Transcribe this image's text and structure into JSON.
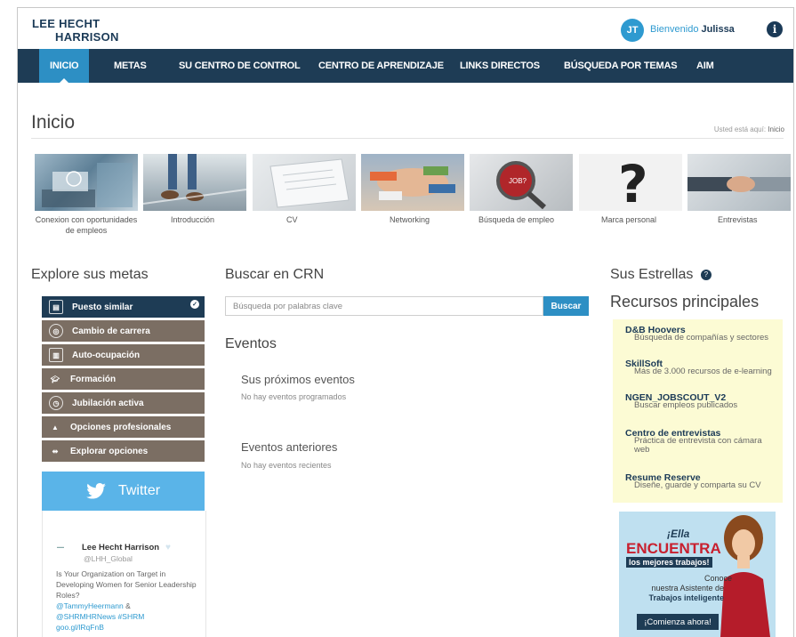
{
  "header": {
    "logo_line1": "LEE HECHT",
    "logo_line2": "HARRISON",
    "avatar_initials": "JT",
    "welcome_text": "Bienvenido",
    "user_name": "Julissa"
  },
  "nav": [
    {
      "label": "INICIO",
      "active": true
    },
    {
      "label": "METAS"
    },
    {
      "label": "SU CENTRO DE CONTROL"
    },
    {
      "label": "CENTRO DE APRENDIZAJE"
    },
    {
      "label": "LINKS DIRECTOS"
    },
    {
      "label": "BÚSQUEDA POR TEMAS"
    },
    {
      "label": "AIM"
    }
  ],
  "page": {
    "title": "Inicio",
    "breadcrumb_prefix": "Usted está aquí:",
    "breadcrumb_current": "Inicio"
  },
  "tiles": [
    {
      "label": "Conexion con oportunidades de empleos",
      "icon": "laptop-hands-image"
    },
    {
      "label": "Introducción",
      "icon": "walking-feet-image"
    },
    {
      "label": "CV",
      "icon": "paper-image"
    },
    {
      "label": "Networking",
      "icon": "stacked-hands-image"
    },
    {
      "label": "Búsqueda de empleo",
      "icon": "magnifier-puzzle-image"
    },
    {
      "label": "Marca personal",
      "icon": "question-mark-image"
    },
    {
      "label": "Entrevistas",
      "icon": "handshake-image"
    }
  ],
  "goals": {
    "heading": "Explore sus metas",
    "items": [
      {
        "label": "Puesto similar",
        "active": true
      },
      {
        "label": "Cambio de carrera"
      },
      {
        "label": "Auto-ocupación"
      },
      {
        "label": "Formación"
      },
      {
        "label": "Jubilación activa"
      },
      {
        "label": "Opciones profesionales"
      },
      {
        "label": "Explorar opciones"
      }
    ],
    "colors": {
      "active": "#1e3c55",
      "inactive": "#7b6e63"
    }
  },
  "twitter": {
    "label": "Twitter",
    "account_name": "Lee Hecht Harrison",
    "handle": "@LHH_Global",
    "tweet_text": "Is Your Organization on Target in Developing Women for Senior Leadership Roles?",
    "tweet_mention": "@TammyHeermann",
    "tweet_amp": "&",
    "tweet_tags": "@SHRMHRNews #SHRM",
    "tweet_url": "goo.gl/lRqFnB"
  },
  "search": {
    "heading": "Buscar en CRN",
    "placeholder": "Búsqueda por palabras clave",
    "button": "Buscar"
  },
  "events": {
    "heading": "Eventos",
    "upcoming_title": "Sus próximos eventos",
    "upcoming_empty": "No hay eventos programados",
    "past_title": "Eventos anteriores",
    "past_empty": "No hay eventos recientes"
  },
  "right": {
    "stars_heading": "Sus Estrellas",
    "resources_heading": "Recursos principales",
    "resources": [
      {
        "title": "D&B Hoovers",
        "desc": "Búsqueda de compañías y sectores"
      },
      {
        "title": "SkillSoft",
        "desc": "Más de 3.000 recursos de e-learning"
      },
      {
        "title": "NGEN_JOBSCOUT_V2",
        "desc": "Buscar empleos publicados"
      },
      {
        "title": "Centro de entrevistas",
        "desc": "Práctica de entrevista con cámara web"
      },
      {
        "title": "Resume Reserve",
        "desc": "Diseñe, guarde y comparta su CV"
      }
    ]
  },
  "ad": {
    "line1": "¡Ella",
    "line2": "ENCUENTRA",
    "line3": "los mejores trabajos!",
    "line4": "Conoce",
    "line5": "nuestra Asistente de",
    "line6": "Trabajos inteligente",
    "cta": "¡Comienza ahora!"
  }
}
